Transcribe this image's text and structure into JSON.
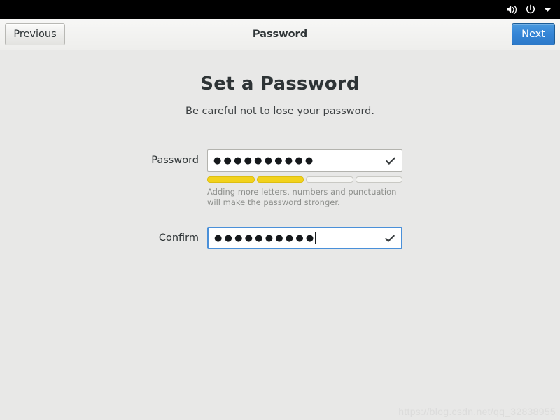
{
  "systembar": {
    "icons": [
      {
        "name": "volume-icon",
        "glyph": "volume"
      },
      {
        "name": "power-icon",
        "glyph": "power"
      },
      {
        "name": "chevron-down-icon",
        "glyph": "chevron-down"
      }
    ],
    "background": "#000000"
  },
  "toolbar": {
    "previous_label": "Previous",
    "title": "Password",
    "next_label": "Next",
    "next_color": "#3584d6"
  },
  "page": {
    "title": "Set a Password",
    "subtitle": "Be careful not to lose your password."
  },
  "form": {
    "password": {
      "label": "Password",
      "value": "●●●●●●●●●●",
      "placeholder": "",
      "valid_icon": "check-icon"
    },
    "confirm": {
      "label": "Confirm",
      "value": "●●●●●●●●●●",
      "placeholder": "",
      "valid_icon": "check-icon",
      "focused": true
    },
    "strength": {
      "segments": 4,
      "filled": 2,
      "fill_color": "#f2d21c",
      "empty_color": "#f4f4f2"
    },
    "hint": "Adding more letters, numbers and punctuation will make the password stronger."
  },
  "watermark": {
    "text": "https://blog.csdn.net/qq_32838955"
  }
}
